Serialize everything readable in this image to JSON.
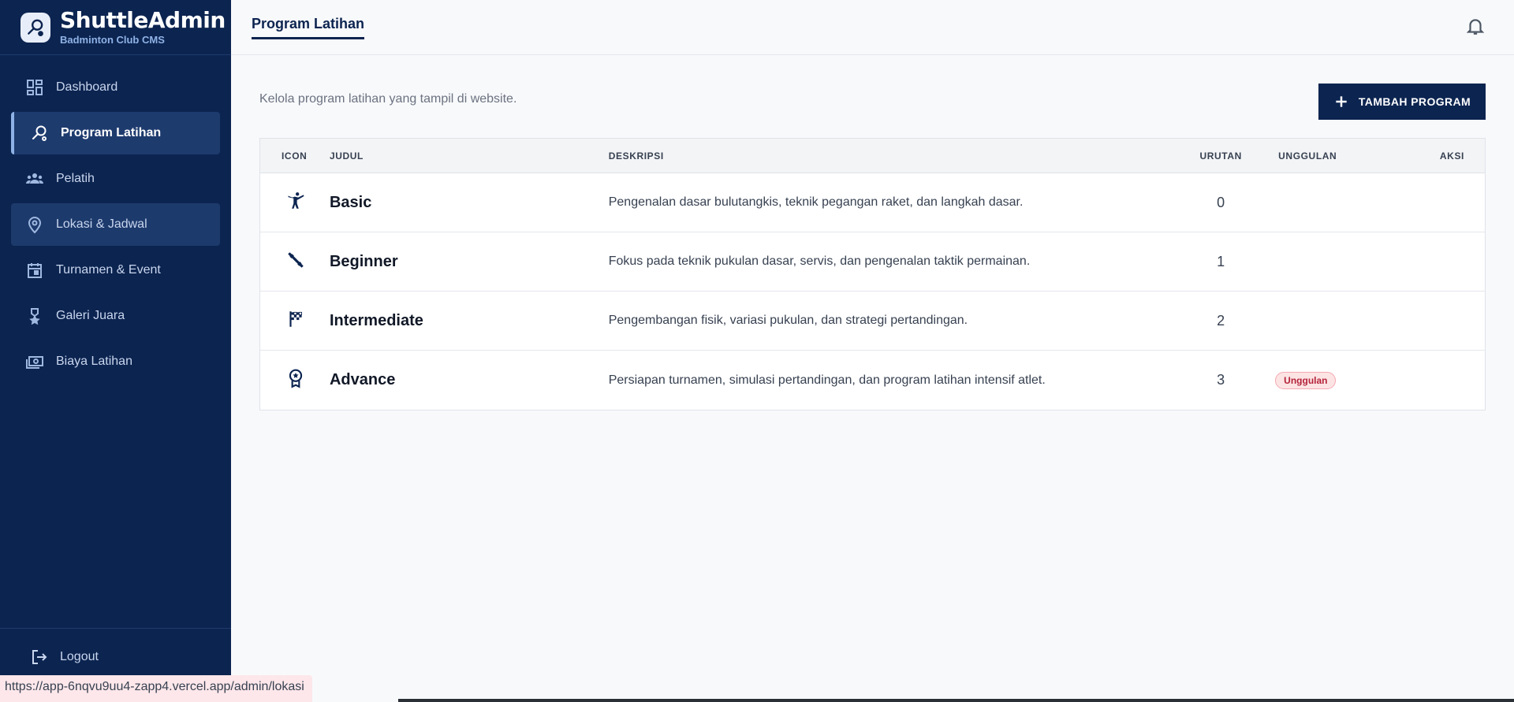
{
  "brand": {
    "title": "ShuttleAdmin",
    "subtitle": "Badminton Club CMS"
  },
  "sidebar": {
    "items": [
      {
        "label": "Dashboard",
        "icon": "dashboard-icon"
      },
      {
        "label": "Program Latihan",
        "icon": "racket-icon"
      },
      {
        "label": "Pelatih",
        "icon": "groups-icon"
      },
      {
        "label": "Lokasi & Jadwal",
        "icon": "location-pin-icon"
      },
      {
        "label": "Turnamen & Event",
        "icon": "calendar-icon"
      },
      {
        "label": "Galeri Juara",
        "icon": "medal-icon"
      },
      {
        "label": "Biaya Latihan",
        "icon": "money-icon"
      }
    ],
    "logout_label": "Logout"
  },
  "topbar": {
    "title": "Program Latihan"
  },
  "main": {
    "description": "Kelola program latihan yang tampil di website.",
    "add_button_label": "TAMBAH PROGRAM"
  },
  "table": {
    "headers": {
      "icon": "ICON",
      "judul": "JUDUL",
      "deskripsi": "DESKRIPSI",
      "urutan": "URUTAN",
      "unggulan": "UNGGULAN",
      "aksi": "AKSI"
    },
    "rows": [
      {
        "icon": "sports-kabaddi-icon",
        "judul": "Basic",
        "deskripsi": "Pengenalan dasar bulutangkis, teknik pegangan raket, dan langkah dasar.",
        "urutan": "0",
        "unggulan": ""
      },
      {
        "icon": "fitness-icon",
        "judul": "Beginner",
        "deskripsi": "Fokus pada teknik pukulan dasar, servis, dan pengenalan taktik permainan.",
        "urutan": "1",
        "unggulan": ""
      },
      {
        "icon": "checkered-flag-icon",
        "judul": "Intermediate",
        "deskripsi": "Pengembangan fisik, variasi pukulan, dan strategi pertandingan.",
        "urutan": "2",
        "unggulan": ""
      },
      {
        "icon": "award-icon",
        "judul": "Advance",
        "deskripsi": "Persiapan turnamen, simulasi pertandingan, dan program latihan intensif atlet.",
        "urutan": "3",
        "unggulan": "Unggulan"
      }
    ]
  },
  "status_bar": {
    "url": "https://app-6nqvu9uu4-zapp4.vercel.app/admin/lokasi"
  },
  "colors": {
    "sidebar_bg": "#0c2450",
    "accent": "#0c2450",
    "badge_bg": "#fde4e4",
    "badge_text": "#b4233a"
  }
}
